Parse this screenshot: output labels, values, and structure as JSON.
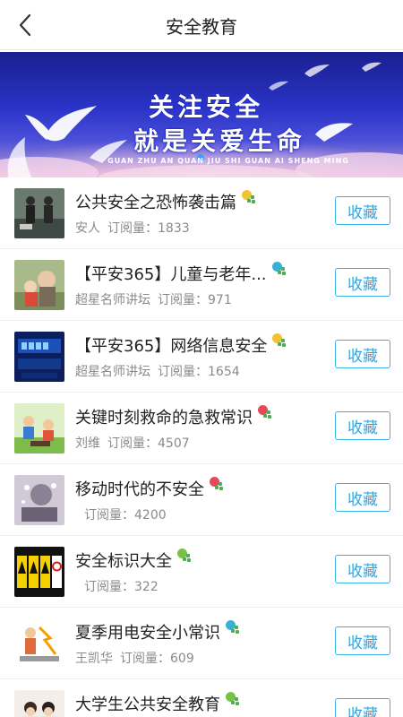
{
  "header": {
    "title": "安全教育",
    "back_icon": "chevron-left-icon"
  },
  "banner": {
    "line1": "关注安全",
    "line2": "就是关爱生命",
    "pinyin": "GUAN ZHU AN QUAN JIU SHI GUAN AI SHENG MING"
  },
  "items": [
    {
      "title": "公共安全之恐怖袭击篇",
      "author": "安人",
      "subs_label": "订阅量：",
      "subs": "1833",
      "fav_label": "收藏",
      "badge_color": "#f2c230"
    },
    {
      "title": "【平安365】儿童与老年...",
      "author": "超星名师讲坛",
      "subs_label": "订阅量：",
      "subs": "971",
      "fav_label": "收藏",
      "badge_color": "#3bb0d6"
    },
    {
      "title": "【平安365】网络信息安全",
      "author": "超星名师讲坛",
      "subs_label": "订阅量：",
      "subs": "1654",
      "fav_label": "收藏",
      "badge_color": "#f2c230"
    },
    {
      "title": "关键时刻救命的急救常识",
      "author": "刘维",
      "subs_label": "订阅量：",
      "subs": "4507",
      "fav_label": "收藏",
      "badge_color": "#e8495a"
    },
    {
      "title": "移动时代的不安全",
      "author": "",
      "subs_label": "订阅量：",
      "subs": "4200",
      "fav_label": "收藏",
      "badge_color": "#e8495a"
    },
    {
      "title": "安全标识大全",
      "author": "",
      "subs_label": "订阅量：",
      "subs": "322",
      "fav_label": "收藏",
      "badge_color": "#7ac143"
    },
    {
      "title": "夏季用电安全小常识",
      "author": "王凯华",
      "subs_label": "订阅量：",
      "subs": "609",
      "fav_label": "收藏",
      "badge_color": "#3bb0d6"
    },
    {
      "title": "大学生公共安全教育",
      "author": "",
      "subs_label": "",
      "subs": "",
      "fav_label": "收藏",
      "badge_color": "#7ac143"
    }
  ]
}
